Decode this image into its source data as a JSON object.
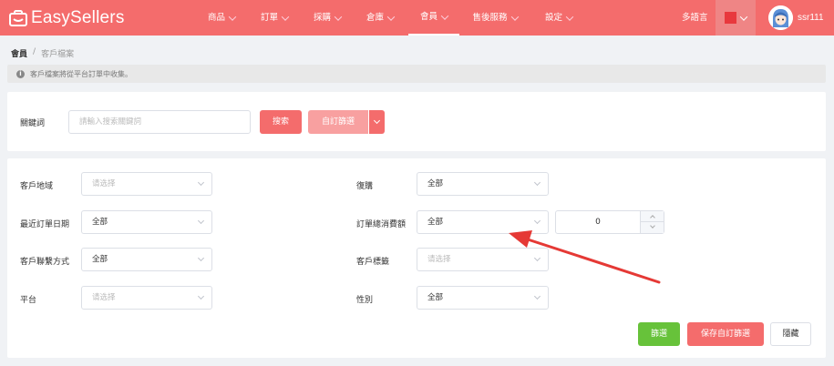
{
  "brand": {
    "name": "EasySellers",
    "accent": "#f46c6c"
  },
  "nav": {
    "items": [
      {
        "label": "商品"
      },
      {
        "label": "訂單"
      },
      {
        "label": "採購"
      },
      {
        "label": "倉庫"
      },
      {
        "label": "會員"
      },
      {
        "label": "售後服務"
      },
      {
        "label": "設定"
      }
    ],
    "active": "會員",
    "language_label": "多語言",
    "username": "ssr111"
  },
  "breadcrumb": {
    "root": "會員",
    "separator": "/",
    "current": "客戶檔案"
  },
  "notice": {
    "text": "客戶檔案將從平台訂單中收集。",
    "icon": "info-icon"
  },
  "search": {
    "keyword_label": "關鍵詞",
    "keyword_placeholder": "請輸入搜索關鍵詞",
    "search_button": "搜索",
    "custom_filter_button": "自訂篩選"
  },
  "filters": {
    "region_label": "客戶地域",
    "region_placeholder": "请选择",
    "repurchase_label": "復購",
    "repurchase_value": "全部",
    "last_order_label": "最近訂單日期",
    "last_order_value": "全部",
    "total_spend_label": "訂單總消費額",
    "total_spend_value": "全部",
    "total_spend_amount": "0",
    "contact_label": "客戶聯繫方式",
    "contact_value": "全部",
    "tag_label": "客戶標籤",
    "tag_placeholder": "请选择",
    "platform_label": "平台",
    "platform_placeholder": "请选择",
    "gender_label": "性別",
    "gender_value": "全部"
  },
  "actions": {
    "filter_button": "篩選",
    "save_filter_button": "保存自訂篩選",
    "hide_button": "隱藏"
  },
  "colors": {
    "primary": "#f46c6c",
    "success": "#67c23a",
    "annotation_arrow": "#e53935"
  }
}
